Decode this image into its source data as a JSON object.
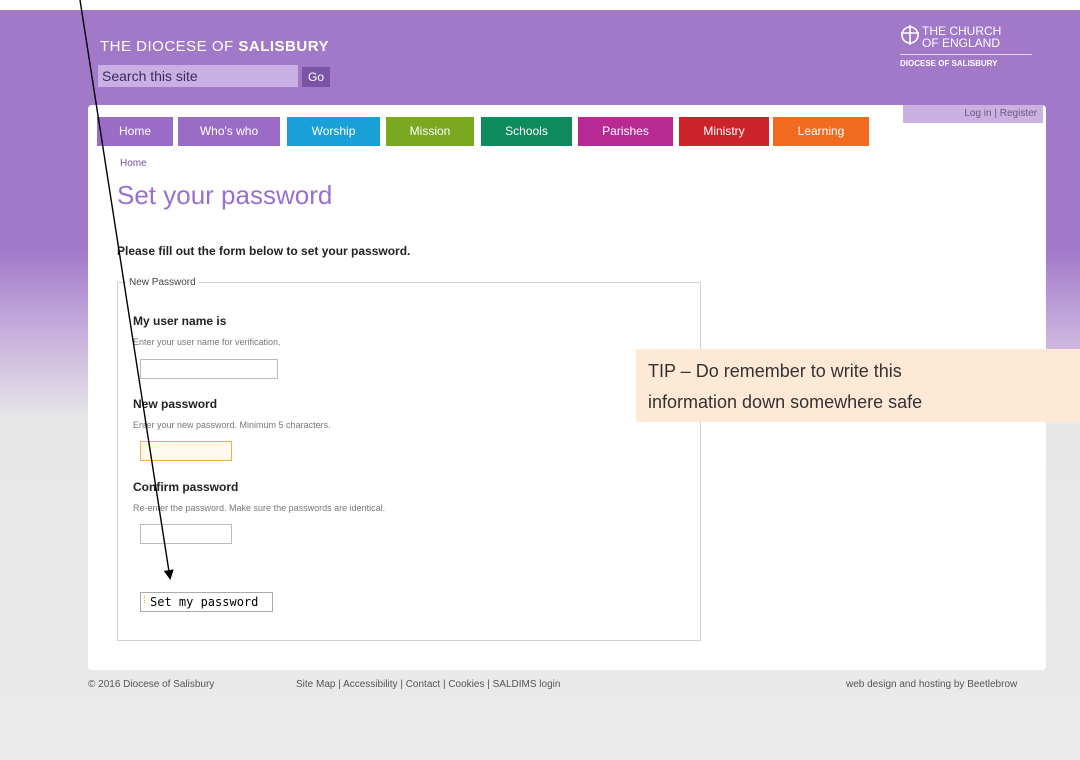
{
  "header": {
    "site_title_prefix": "THE DIOCESE OF",
    "site_title_name": "SALISBURY",
    "search_placeholder": "Search this site",
    "search_button": "Go",
    "logo_line1": "THE CHURCH",
    "logo_line2": "OF ENGLAND",
    "logo_line3": "DIOCESE OF SALISBURY"
  },
  "nav": {
    "items": [
      {
        "label": "Home",
        "color": "#9b6cc6"
      },
      {
        "label": "Who's who",
        "color": "#9b6cc6"
      },
      {
        "label": "Worship",
        "color": "#1aa0d8"
      },
      {
        "label": "Mission",
        "color": "#7aa820"
      },
      {
        "label": "Schools",
        "color": "#0f8a5c"
      },
      {
        "label": "Parishes",
        "color": "#b82a93"
      },
      {
        "label": "Ministry",
        "color": "#cc2229"
      },
      {
        "label": "Learning",
        "color": "#f26a1f"
      }
    ]
  },
  "account": {
    "login": "Log in",
    "separator": "|",
    "register": "Register"
  },
  "breadcrumb": "Home",
  "page_title": "Set your password",
  "intro": "Please fill out the form below to set your password.",
  "form": {
    "legend": "New Password",
    "username": {
      "label": "My user name is",
      "description": "Enter your user name for verification.",
      "value": ""
    },
    "new_password": {
      "label": "New password",
      "description": "Enter your new password. Minimum 5 characters.",
      "value": ""
    },
    "confirm_password": {
      "label": "Confirm password",
      "description": "Re-enter the password. Make sure the passwords are identical.",
      "value": ""
    },
    "submit": "Set my password"
  },
  "tip": {
    "line1": "TIP – Do remember to write this",
    "line2": "information down somewhere safe"
  },
  "footer": {
    "copyright": "© 2016 Diocese of Salisbury",
    "links": [
      "Site Map",
      "Accessibility",
      "Contact",
      "Cookies",
      "SALDIMS login"
    ],
    "link_sep": " | ",
    "credit": "web design and hosting by Beetlebrow"
  }
}
